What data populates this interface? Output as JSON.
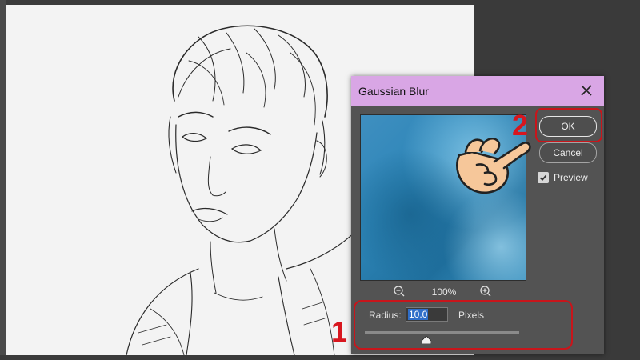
{
  "dialog": {
    "title": "Gaussian Blur",
    "ok_label": "OK",
    "cancel_label": "Cancel",
    "preview_label": "Preview",
    "preview_checked": true,
    "zoom_level": "100%",
    "radius_label": "Radius:",
    "radius_value": "10.0",
    "units_label": "Pixels",
    "radius_slider_fraction": 0.4
  },
  "annotations": {
    "step_1": "1",
    "step_2": "2"
  },
  "colors": {
    "title_bar": "#d9a6e5",
    "dialog_bg": "#535353",
    "highlight": "#c8151b",
    "selection": "#2f6ec9"
  },
  "icons": [
    "close-icon",
    "zoom-out-icon",
    "zoom-in-icon",
    "checkmark-icon",
    "pointing-hand-icon"
  ]
}
